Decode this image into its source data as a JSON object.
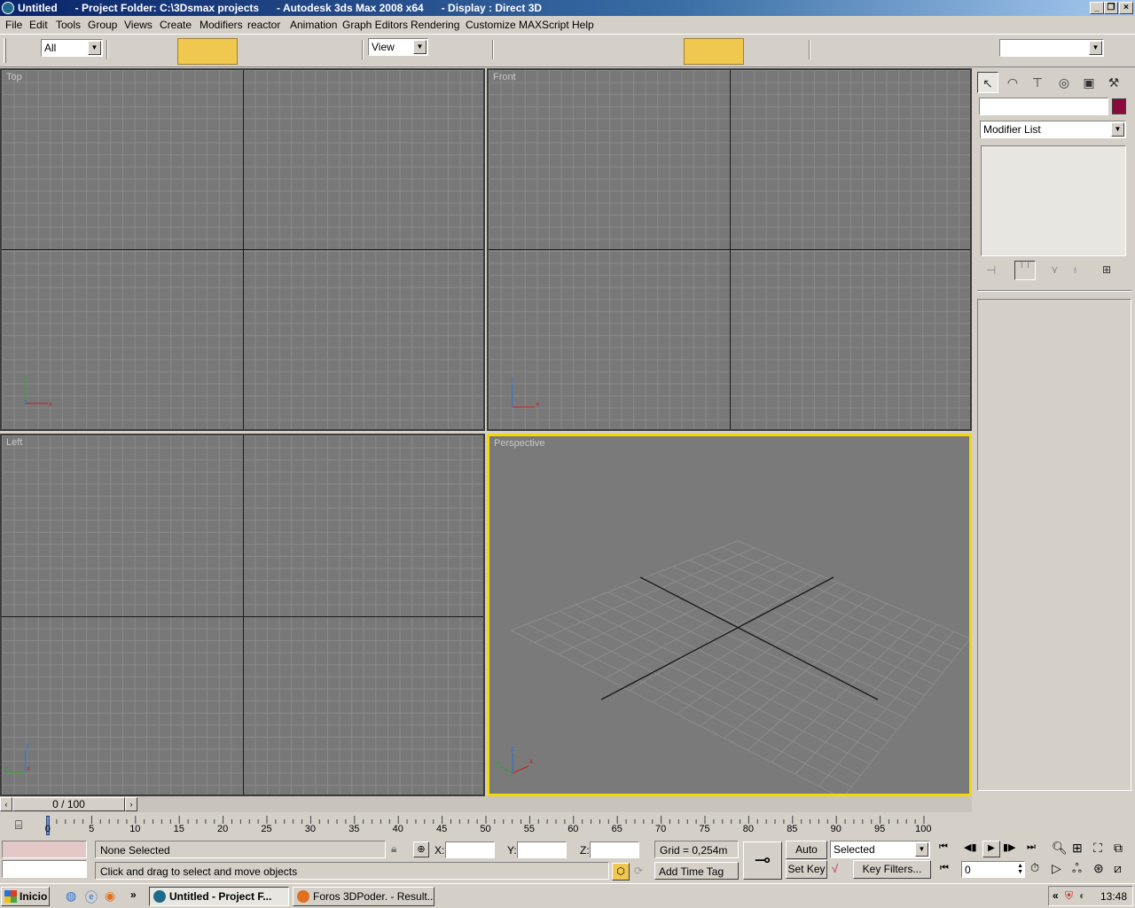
{
  "window": {
    "title": "Untitled      - Project Folder: C:\\3Dsmax projects      - Autodesk 3ds Max 2008 x64      - Display : Direct 3D"
  },
  "menu": [
    "File",
    "Edit",
    "Tools",
    "Group",
    "Views",
    "Create",
    "Modifiers",
    "reactor",
    "Animation",
    "Graph Editors",
    "Rendering",
    "Customize",
    "MAXScript",
    "Help"
  ],
  "toolbar": {
    "selection_filter": "All",
    "reference_coord": "View",
    "named_selection": ""
  },
  "viewports": {
    "top": "Top",
    "front": "Front",
    "left": "Left",
    "perspective": "Perspective"
  },
  "axes": {
    "x": "x",
    "y": "y",
    "z": "z"
  },
  "command_panel": {
    "tabs": [
      "create-icon",
      "modify-icon",
      "hierarchy-icon",
      "motion-icon",
      "display-icon",
      "utilities-icon"
    ],
    "object_name": "",
    "object_color": "#8b0a3c",
    "modifier_list": "Modifier List"
  },
  "timeline": {
    "frame_display": "0 / 100",
    "ticks": [
      "0",
      "5",
      "10",
      "15",
      "20",
      "25",
      "30",
      "35",
      "40",
      "45",
      "50",
      "55",
      "60",
      "65",
      "70",
      "75",
      "80",
      "85",
      "90",
      "95",
      "100"
    ]
  },
  "status": {
    "selection": "None Selected",
    "prompt": "Click and drag to select and move objects",
    "x_label": "X:",
    "y_label": "Y:",
    "z_label": "Z:",
    "x_value": "",
    "y_value": "",
    "z_value": "",
    "grid": "Grid = 0,254m",
    "add_time_tag": "Add Time Tag",
    "auto_key": "Auto Key",
    "set_key": "Set Key",
    "key_mode": "Selected",
    "key_filters": "Key Filters...",
    "current_frame": "0"
  },
  "taskbar": {
    "start": "Inicio",
    "chevron": "»",
    "tasks": [
      "Untitled      - Project F...",
      "Foros 3DPoder. - Result..."
    ],
    "tray_chevron": "«",
    "clock": "13:48"
  }
}
